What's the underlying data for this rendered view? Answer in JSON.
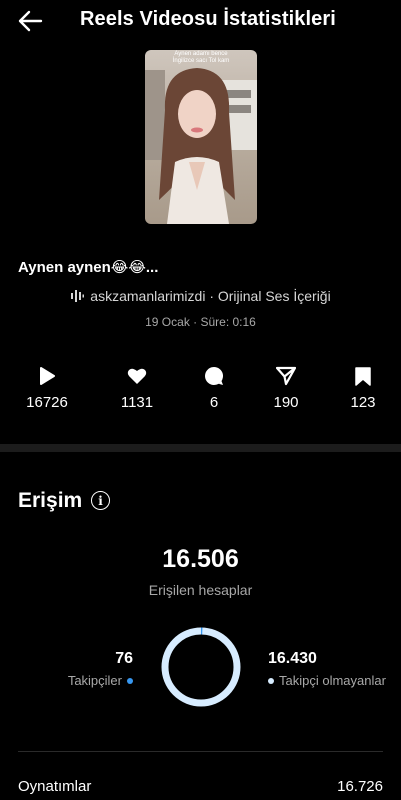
{
  "header": {
    "title": "Reels Videosu İstatistikleri",
    "back_icon": "arrow-left-icon"
  },
  "thumbnail": {
    "overlay_line1": "Aynen adamı bence",
    "overlay_line2": "İngilizce sacı Tol kam"
  },
  "caption": "Aynen aynen😂😂...",
  "audio": {
    "icon": "audio-waveform-icon",
    "text": "askzamanlarimizdi · Orijinal Ses İçeriği"
  },
  "meta": "19 Ocak · Süre: 0:16",
  "stats": [
    {
      "icon": "play-icon",
      "value": "16726"
    },
    {
      "icon": "heart-icon",
      "value": "1131"
    },
    {
      "icon": "comment-icon",
      "value": "6"
    },
    {
      "icon": "share-icon",
      "value": "190"
    },
    {
      "icon": "bookmark-icon",
      "value": "123"
    }
  ],
  "reach": {
    "title": "Erişim",
    "info_icon": "i",
    "total": "16.506",
    "total_label": "Erişilen hesaplar",
    "followers": {
      "value": "76",
      "label": "Takipçiler",
      "color": "#3797f0"
    },
    "non_followers": {
      "value": "16.430",
      "label": "Takipçi olmayanlar",
      "color": "#d7ecff"
    },
    "followers_fraction": 0.0046
  },
  "plays": {
    "label": "Oynatımlar",
    "value": "16.726"
  }
}
